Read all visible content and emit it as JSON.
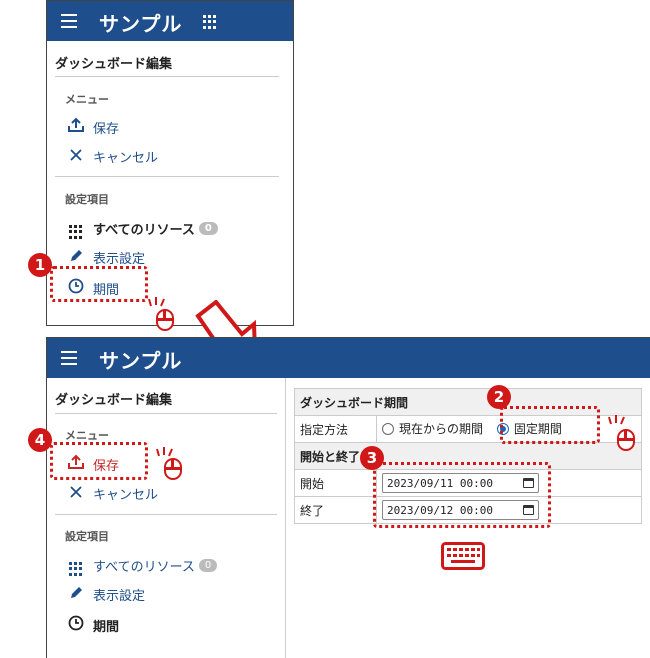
{
  "app": {
    "title": "サンプル"
  },
  "sidebar": {
    "section_title": "ダッシュボード編集",
    "menu_label": "メニュー",
    "save_label": "保存",
    "cancel_label": "キャンセル",
    "settings_label": "設定項目",
    "all_resources_label": "すべてのリソース",
    "all_resources_count": "0",
    "display_settings_label": "表示設定",
    "period_label": "期間"
  },
  "form": {
    "title": "ダッシュボード期間",
    "method_label": "指定方法",
    "option_relative": "現在からの期間",
    "option_fixed": "固定期間",
    "range_header": "開始と終了",
    "start_label": "開始",
    "start_value": "2023/09/11 00:00",
    "end_label": "終了",
    "end_value": "2023/09/12 00:00"
  },
  "steps": {
    "s1": "1",
    "s2": "2",
    "s3": "3",
    "s4": "4"
  },
  "colors": {
    "header": "#1f4e8c",
    "link": "#1f4e8c",
    "highlight": "#d01818",
    "radio": "#1565c0"
  }
}
